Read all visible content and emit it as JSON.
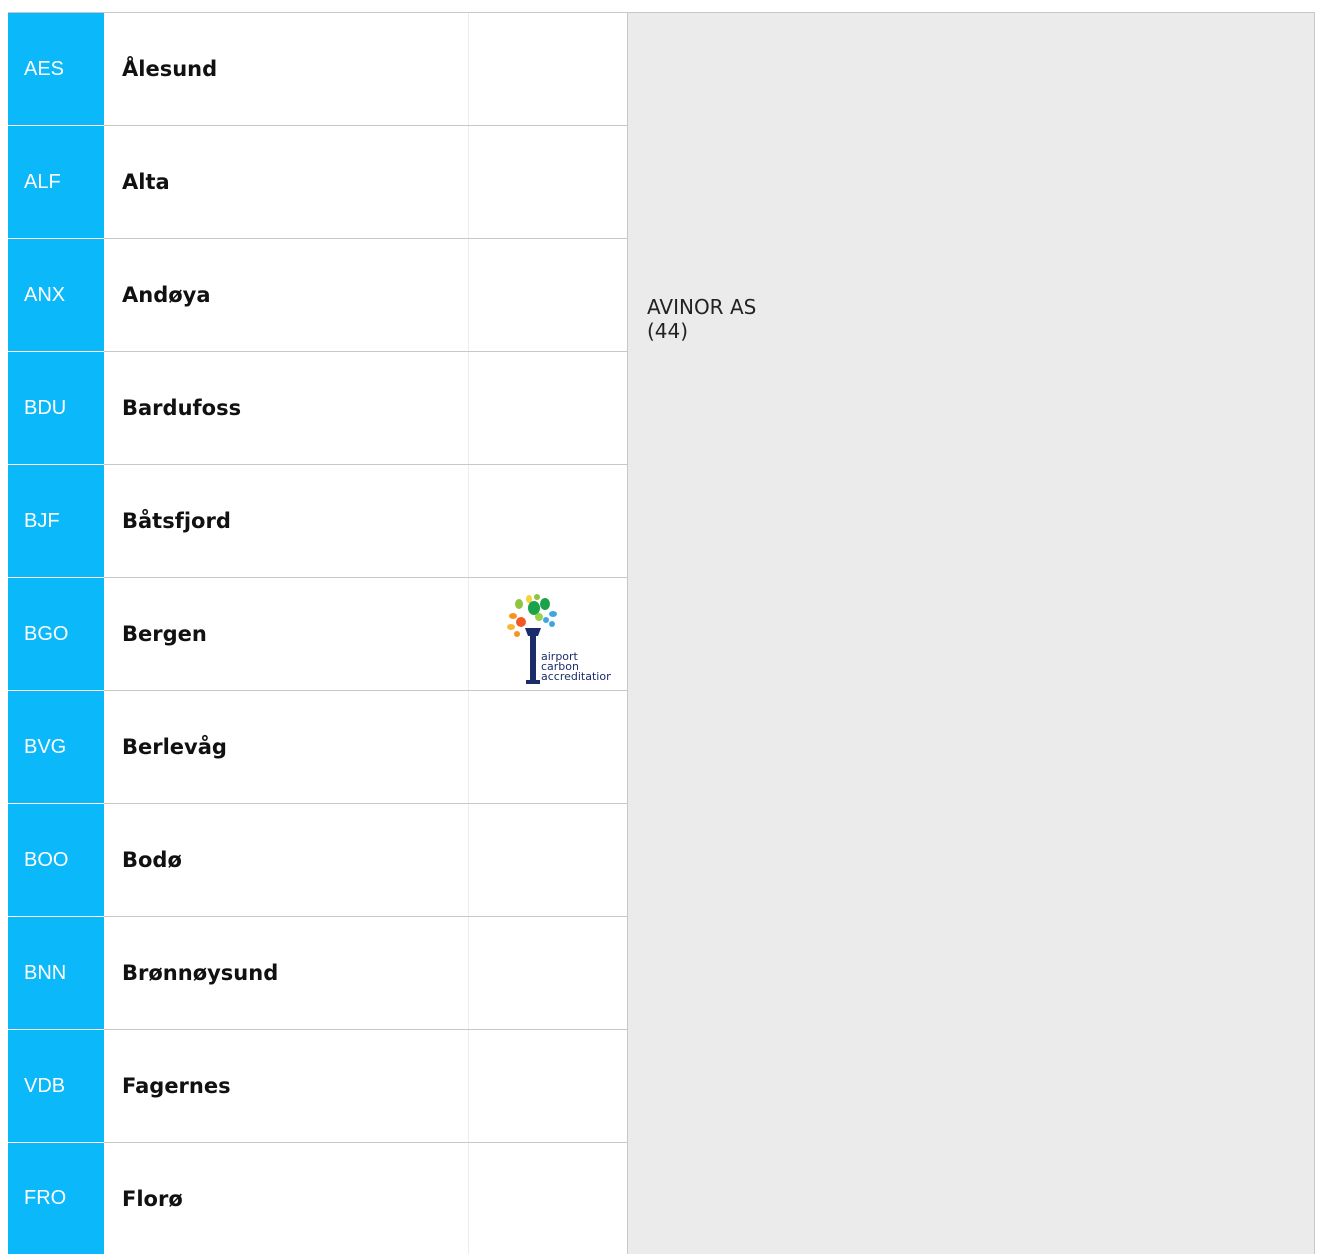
{
  "airports": [
    {
      "code": "AES",
      "name": "Ålesund"
    },
    {
      "code": "ALF",
      "name": "Alta"
    },
    {
      "code": "ANX",
      "name": "Andøya"
    },
    {
      "code": "BDU",
      "name": "Bardufoss"
    },
    {
      "code": "BJF",
      "name": "Båtsfjord"
    },
    {
      "code": "BGO",
      "name": "Bergen"
    },
    {
      "code": "BVG",
      "name": "Berlevåg"
    },
    {
      "code": "BOO",
      "name": "Bodø"
    },
    {
      "code": "BNN",
      "name": "Brønnøysund"
    },
    {
      "code": "VDB",
      "name": "Fagernes"
    },
    {
      "code": "FRO",
      "name": "Florø"
    }
  ],
  "operator": {
    "name": "AVINOR AS",
    "count": "(44)"
  },
  "badge": {
    "line1": "airport",
    "line2": "carbon",
    "line3": "accreditation",
    "icon": "airport-carbon-accreditation-logo"
  },
  "colors": {
    "code_bg": "#0bb8f9",
    "panel_bg": "#ebebeb"
  }
}
